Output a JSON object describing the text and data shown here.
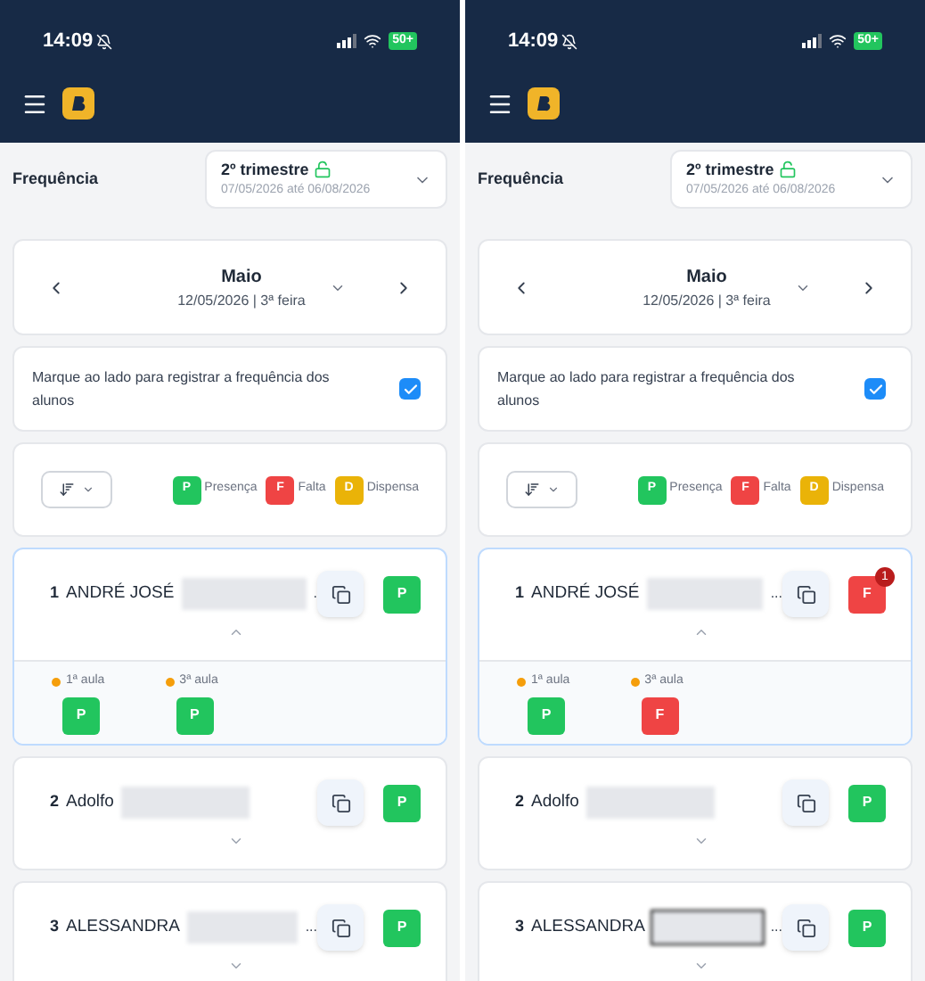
{
  "screens": [
    {
      "status_bar": {
        "time": "14:09",
        "battery": "50+"
      },
      "page_title": "Frequência",
      "period": {
        "title": "2º trimestre",
        "range": "07/05/2026 até 06/08/2026",
        "unlocked": true
      },
      "month": {
        "name": "Maio",
        "date": "12/05/2026 | 3ª feira"
      },
      "register_option": {
        "label": "Marque ao lado para registrar a frequência dos alunos",
        "checked": true
      },
      "legend": [
        {
          "letter": "P",
          "label": "Presença",
          "color": "#22c55e"
        },
        {
          "letter": "F",
          "label": "Falta",
          "color": "#ef4444"
        },
        {
          "letter": "D",
          "label": "Dispensa",
          "color": "#eab308"
        }
      ],
      "students": [
        {
          "number": "1",
          "name": "ANDRÉ JOSÉ",
          "redaction": {
            "outlined": false
          },
          "ellipsis": ".",
          "status": {
            "kind": "present",
            "letter": "P"
          },
          "expanded": true,
          "lessons": [
            {
              "label": "1ª aula",
              "mark": {
                "kind": "present",
                "letter": "P"
              }
            },
            {
              "label": "3ª aula",
              "mark": {
                "kind": "present",
                "letter": "P"
              }
            }
          ]
        },
        {
          "number": "2",
          "name": "Adolfo",
          "redaction": {
            "outlined": false
          },
          "status": {
            "kind": "present",
            "letter": "P"
          },
          "expanded": false
        },
        {
          "number": "3",
          "name": "ALESSANDRA",
          "redaction": {
            "outlined": false
          },
          "ellipsis": "...",
          "status": {
            "kind": "present",
            "letter": "P"
          },
          "expanded": false
        }
      ]
    },
    {
      "status_bar": {
        "time": "14:09",
        "battery": "50+"
      },
      "page_title": "Frequência",
      "period": {
        "title": "2º trimestre",
        "range": "07/05/2026 até 06/08/2026",
        "unlocked": true
      },
      "month": {
        "name": "Maio",
        "date": "12/05/2026 | 3ª feira"
      },
      "register_option": {
        "label": "Marque ao lado para registrar a frequência dos alunos",
        "checked": true
      },
      "legend": [
        {
          "letter": "P",
          "label": "Presença",
          "color": "#22c55e"
        },
        {
          "letter": "F",
          "label": "Falta",
          "color": "#ef4444"
        },
        {
          "letter": "D",
          "label": "Dispensa",
          "color": "#eab308"
        }
      ],
      "students": [
        {
          "number": "1",
          "name": "ANDRÉ JOSÉ",
          "redaction": {
            "outlined": false
          },
          "ellipsis": "...",
          "status": {
            "kind": "absent",
            "letter": "F",
            "badge": "1"
          },
          "expanded": true,
          "lessons": [
            {
              "label": "1ª aula",
              "mark": {
                "kind": "present",
                "letter": "P"
              }
            },
            {
              "label": "3ª aula",
              "mark": {
                "kind": "absent",
                "letter": "F"
              }
            }
          ]
        },
        {
          "number": "2",
          "name": "Adolfo",
          "redaction": {
            "outlined": false
          },
          "status": {
            "kind": "present",
            "letter": "P"
          },
          "expanded": false
        },
        {
          "number": "3",
          "name": "ALESSANDRA",
          "redaction": {
            "outlined": true
          },
          "ellipsis": "...",
          "status": {
            "kind": "present",
            "letter": "P"
          },
          "expanded": false
        }
      ]
    }
  ]
}
